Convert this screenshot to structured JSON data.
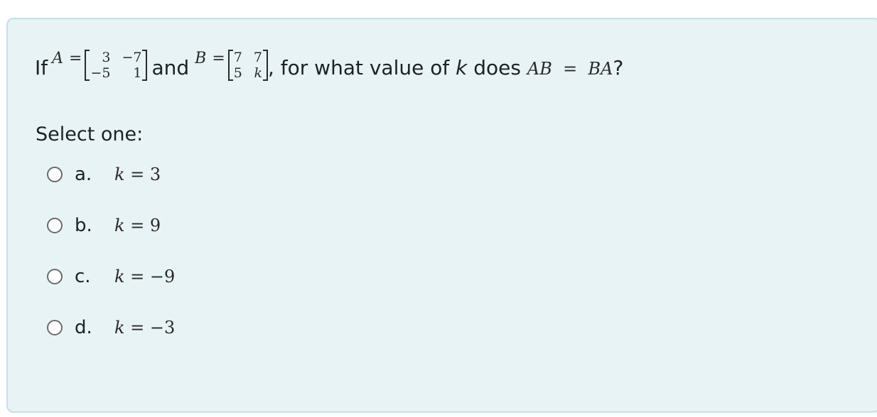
{
  "question": {
    "prefix": "If",
    "matrix_a": {
      "name": "A",
      "rows": [
        [
          "3",
          "−7"
        ],
        [
          "−5",
          "1"
        ]
      ]
    },
    "conjunction": "and",
    "matrix_b": {
      "name": "B",
      "rows": [
        [
          "7",
          "7"
        ],
        [
          "5",
          "k"
        ]
      ]
    },
    "equals_sign": "=",
    "middle_text": ", for what value of ",
    "variable": "k",
    "tail_text": " does ",
    "condition": "AB  =  BA",
    "end": "?"
  },
  "prompt": "Select one:",
  "options": [
    {
      "letter": "a.",
      "variable": "k",
      "expr": " = 3",
      "selected": false
    },
    {
      "letter": "b.",
      "variable": "k",
      "expr": " = 9",
      "selected": false
    },
    {
      "letter": "c.",
      "variable": "k",
      "expr": " = −9",
      "selected": false
    },
    {
      "letter": "d.",
      "variable": "k",
      "expr": " = −3",
      "selected": false
    }
  ],
  "colors": {
    "box_background": "#e7f3f5",
    "box_border": "#c1e2e8",
    "text": "#1d2125",
    "radio_border": "#6c6c6c"
  }
}
